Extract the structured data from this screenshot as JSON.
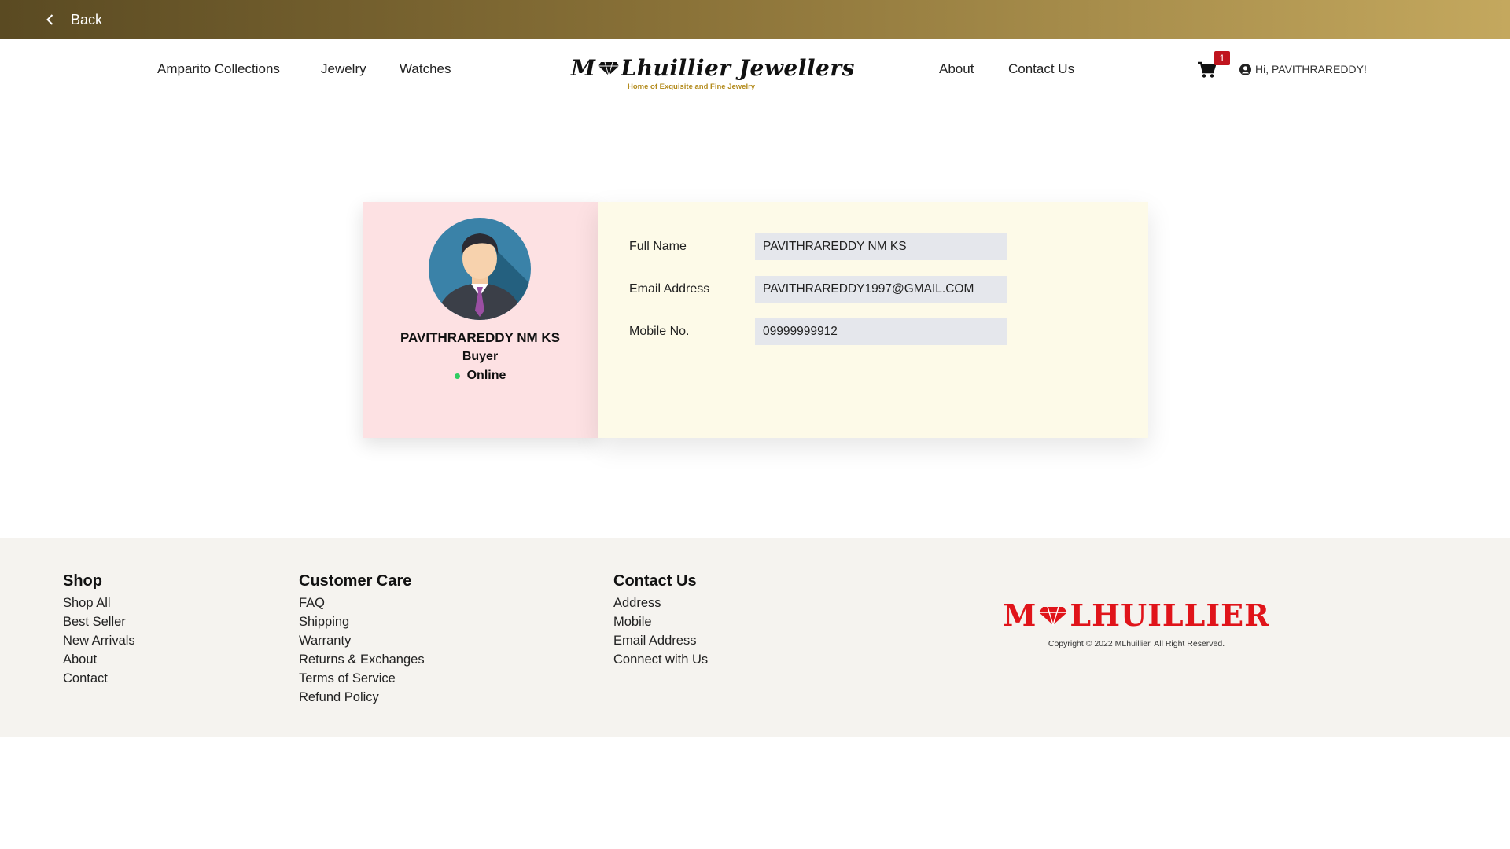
{
  "topbar": {
    "back_label": "Back"
  },
  "nav": {
    "left": [
      "Amparito Collections",
      "Jewelry",
      "Watches"
    ],
    "right": [
      "About",
      "Contact Us"
    ],
    "logo_text": "M Lhuillier Jewellers",
    "logo_tagline": "Home of Exquisite and Fine Jewelry",
    "cart_count": "1",
    "greeting": "Hi, PAVITHRAREDDY!"
  },
  "profile": {
    "name": "PAVITHRAREDDY NM KS",
    "role": "Buyer",
    "status": "Online",
    "fields": [
      {
        "label": "Full Name",
        "value": "PAVITHRAREDDY NM KS"
      },
      {
        "label": "Email Address",
        "value": "PAVITHRAREDDY1997@GMAIL.COM"
      },
      {
        "label": "Mobile No.",
        "value": "09999999912"
      }
    ]
  },
  "footer": {
    "shop": {
      "title": "Shop",
      "links": [
        "Shop All",
        "Best Seller",
        "New Arrivals",
        "About",
        "Contact"
      ]
    },
    "care": {
      "title": "Customer Care",
      "links": [
        "FAQ",
        "Shipping",
        "Warranty",
        "Returns & Exchanges",
        "Terms of Service",
        "Refund Policy"
      ]
    },
    "contact": {
      "title": "Contact Us",
      "links": [
        "Address",
        "Mobile",
        "Email Address",
        "Connect with Us"
      ]
    },
    "brand_text": "MLHUILLIER",
    "copyright": "Copyright © 2022 MLhuillier, All Right Reserved."
  },
  "colors": {
    "brand_red": "#e0141a",
    "gold": "#b38b1d",
    "online": "#2fcc61"
  }
}
